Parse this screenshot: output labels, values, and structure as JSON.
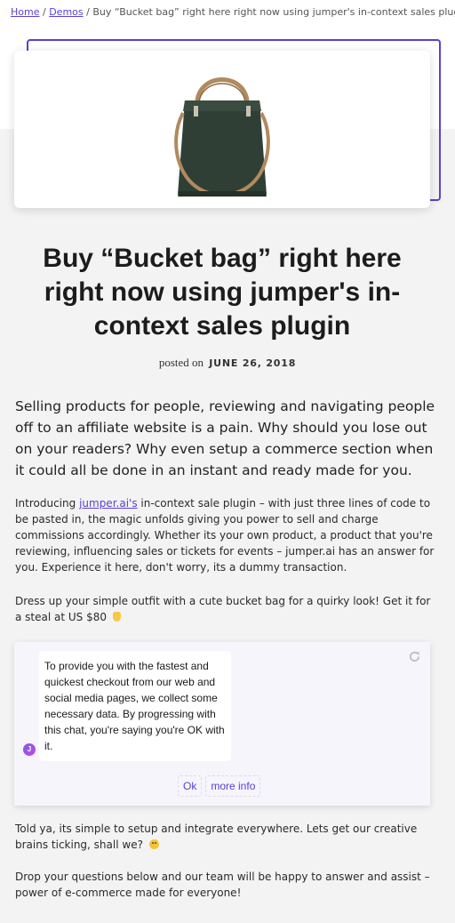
{
  "breadcrumb": {
    "home": "Home",
    "sep1": "/",
    "demos": "Demos",
    "sep2": "/",
    "current": "Buy “Bucket bag” right here right now using jumper's in-context sales plugin"
  },
  "article": {
    "title": "Buy “Bucket bag” right here right now using jumper's in-context sales plugin",
    "posted_label": "posted on",
    "date": "JUNE 26, 2018",
    "lead": "Selling products for people, reviewing and navigating people off to an affiliate website is a pain. Why should you lose out on your readers? Why even setup a commerce section when it could all be done in an instant and ready made for you.",
    "p1_before": "Introducing ",
    "p1_link": "jumper.ai's",
    "p1_after": " in-context sale plugin – with just three lines of code to be pasted in, the magic unfolds giving you power to sell and charge commissions accordingly. Whether its your own product, a product that you're reviewing, influencing sales or tickets for events – jumper.ai has an answer for you. Experience it here, don't worry, its a dummy transaction.",
    "p2": "Dress up your simple outfit with a cute bucket bag for a quirky look! Get it for a steal at US $80",
    "p3": "Told ya, its simple to setup and integrate everywhere. Lets get our creative brains ticking, shall we?",
    "p4": "Drop your questions below and our team will be happy to answer and assist – power of e-commerce made for everyone!"
  },
  "chat": {
    "message": "To provide you with the fastest and quickest checkout from our web and social media pages, we collect some necessary data. By progressing with this chat, you're saying you're OK with it.",
    "avatar_letter": "J",
    "ok_label": "Ok",
    "more_info_label": "more info"
  },
  "icons": {
    "refresh": "refresh-icon",
    "pointing_down_emoji": "pointing-down-emoji",
    "smile_emoji": "smile-emoji"
  },
  "colors": {
    "accent": "#5b3fd6",
    "bag": "#2f3f35",
    "handle": "#b08a5e"
  }
}
